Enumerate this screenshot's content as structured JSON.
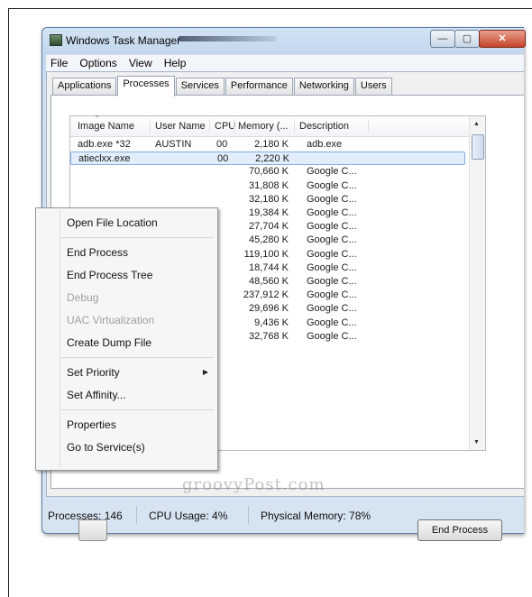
{
  "window": {
    "title": "Windows Task Manager",
    "min": "—",
    "max": "▢",
    "close": "✕"
  },
  "menu": [
    "File",
    "Options",
    "View",
    "Help"
  ],
  "tabs": [
    "Applications",
    "Processes",
    "Services",
    "Performance",
    "Networking",
    "Users"
  ],
  "active_tab": "Processes",
  "table": {
    "columns": [
      "Image Name",
      "User Name",
      "CPU",
      "Memory (...",
      "Description"
    ],
    "rows": [
      {
        "image": "adb.exe *32",
        "user": "AUSTIN",
        "cpu": "00",
        "memory": "2,180 K",
        "desc": "adb.exe"
      },
      {
        "image": "atieclxx.exe",
        "user": "",
        "cpu": "00",
        "memory": "2,220 K",
        "desc": ""
      },
      {
        "image": "",
        "user": "",
        "cpu": "",
        "memory": "70,660 K",
        "desc": "Google C..."
      },
      {
        "image": "",
        "user": "",
        "cpu": "",
        "memory": "31,808 K",
        "desc": "Google C..."
      },
      {
        "image": "",
        "user": "",
        "cpu": "",
        "memory": "32,180 K",
        "desc": "Google C..."
      },
      {
        "image": "",
        "user": "",
        "cpu": "",
        "memory": "19,384 K",
        "desc": "Google C..."
      },
      {
        "image": "",
        "user": "",
        "cpu": "",
        "memory": "27,704 K",
        "desc": "Google C..."
      },
      {
        "image": "",
        "user": "",
        "cpu": "",
        "memory": "45,280 K",
        "desc": "Google C..."
      },
      {
        "image": "",
        "user": "",
        "cpu": "",
        "memory": "119,100 K",
        "desc": "Google C..."
      },
      {
        "image": "",
        "user": "",
        "cpu": "",
        "memory": "18,744 K",
        "desc": "Google C..."
      },
      {
        "image": "",
        "user": "",
        "cpu": "",
        "memory": "48,560 K",
        "desc": "Google C..."
      },
      {
        "image": "",
        "user": "",
        "cpu": "",
        "memory": "237,912 K",
        "desc": "Google C..."
      },
      {
        "image": "",
        "user": "",
        "cpu": "",
        "memory": "29,696 K",
        "desc": "Google C..."
      },
      {
        "image": "",
        "user": "",
        "cpu": "",
        "memory": "9,436 K",
        "desc": "Google C..."
      },
      {
        "image": "",
        "user": "",
        "cpu": "",
        "memory": "32,768 K",
        "desc": "Google C..."
      }
    ],
    "selected_row": 1
  },
  "context_menu": [
    {
      "label": "Open File Location",
      "disabled": false,
      "submenu": false,
      "sep_before": false
    },
    {
      "label": "End Process",
      "disabled": false,
      "submenu": false,
      "sep_before": true
    },
    {
      "label": "End Process Tree",
      "disabled": false,
      "submenu": false,
      "sep_before": false
    },
    {
      "label": "Debug",
      "disabled": true,
      "submenu": false,
      "sep_before": false
    },
    {
      "label": "UAC Virtualization",
      "disabled": true,
      "submenu": false,
      "sep_before": false
    },
    {
      "label": "Create Dump File",
      "disabled": false,
      "submenu": false,
      "sep_before": false
    },
    {
      "label": "Set Priority",
      "disabled": false,
      "submenu": true,
      "sep_before": true
    },
    {
      "label": "Set Affinity...",
      "disabled": false,
      "submenu": false,
      "sep_before": false
    },
    {
      "label": "Properties",
      "disabled": false,
      "submenu": false,
      "sep_before": true
    },
    {
      "label": "Go to Service(s)",
      "disabled": false,
      "submenu": false,
      "sep_before": false
    }
  ],
  "buttons": {
    "end_process": "End Process"
  },
  "status": {
    "processes": "Processes: 146",
    "cpu": "CPU Usage: 4%",
    "memory": "Physical Memory: 78%"
  },
  "watermark": "groovyPost.com"
}
